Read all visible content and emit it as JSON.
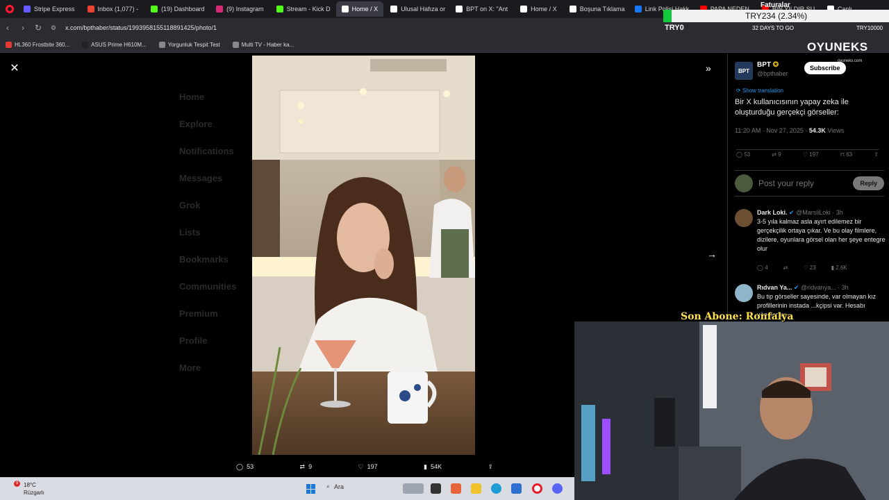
{
  "browser": {
    "tabs": [
      {
        "label": "Stripe Express",
        "color": "#635bff"
      },
      {
        "label": "Inbox (1,077) -",
        "color": "#ea4335"
      },
      {
        "label": "(19) Dashboard",
        "color": "#53fc18"
      },
      {
        "label": "(9) Instagram",
        "color": "#d62976"
      },
      {
        "label": "Stream - Kick D",
        "color": "#53fc18"
      },
      {
        "label": "Home / X",
        "color": "#ffffff",
        "active": true
      },
      {
        "label": "Ulusal Hafıza or",
        "color": "#ffffff"
      },
      {
        "label": "BPT on X: \"Ant",
        "color": "#ffffff"
      },
      {
        "label": "Home / X",
        "color": "#ffffff"
      },
      {
        "label": "Boşuna Tıklama",
        "color": "#ffffff"
      },
      {
        "label": "Link Polisi Hakk",
        "color": "#1877f2"
      },
      {
        "label": "PAPA NEDEN",
        "color": "#ff0000"
      },
      {
        "label": "BİN YILDIR SU",
        "color": "#ff0000"
      },
      {
        "label": "Canlı",
        "color": "#ffffff"
      }
    ],
    "url": "x.com/bpthaber/status/1993958155118891425/photo/1",
    "bookmarks": [
      {
        "label": "HL360 Frostbite 360...",
        "color": "#e53935"
      },
      {
        "label": "ASUS Prime H610M...",
        "color": "#222222"
      },
      {
        "label": "Yorgunluk Tespit Test",
        "color": "#888888"
      },
      {
        "label": "Multi TV - Haber ka...",
        "color": "#888888"
      }
    ]
  },
  "overlay": {
    "ticker_label": "Faturalar",
    "ticker_pair": "TRY234 (2.34%)",
    "try_left": "TRY0",
    "days_to_go": "32 DAYS TO GO",
    "try_right": "TRY10000",
    "logo": "OYUNEKS",
    "logo_sub": "oyuneks.com",
    "son_abone": "Son Abone: Ronfalya"
  },
  "xpage_ghost": [
    "Home",
    "Explore",
    "Notifications",
    "Messages",
    "Grok",
    "Lists",
    "Bookmarks",
    "Communities",
    "Premium",
    "Profile",
    "More"
  ],
  "media": {
    "actions": {
      "replies": "53",
      "reposts": "9",
      "likes": "197",
      "views": "54K"
    }
  },
  "tweet": {
    "name": "BPT",
    "handle": "@bpthaber",
    "subscribe": "Subscribe",
    "show_translation": "Show translation",
    "text": "Bir X kullanıcısının yapay zeka ile oluşturduğu gerçekçi görseller:",
    "time": "11:20 AM · Nov 27, 2025 · ",
    "views_count": "54.3K",
    "views_label": " Views",
    "stats": {
      "replies": "53",
      "reposts": "9",
      "likes": "197",
      "bookmarks": "63"
    },
    "reply_placeholder": "Post your reply",
    "reply_button": "Reply"
  },
  "comments": [
    {
      "name": "Dark Loki.",
      "handle": "@MarsliLoki · 3h",
      "text": "3-5 yıla kalmaz asla ayırt edilemez bir gerçekçilik ortaya çıkar. Ve bu olay filmlere, dizilere, oyunlara görsel olan her şeye entegre olur",
      "replies": "4",
      "likes": "23",
      "views": "2.6K"
    },
    {
      "name": "Rıdvan Ya...",
      "handle": "@ridvanya... · 3h",
      "text": "Bu tip görseller sayesinde, var olmayan kız profillerinin instada ...kçipsi var. Hesabı yönetenler"
    }
  ],
  "taskbar": {
    "temp": "18°C",
    "weather": "Rüzgarlı",
    "badge": "9",
    "search": "Ara"
  }
}
